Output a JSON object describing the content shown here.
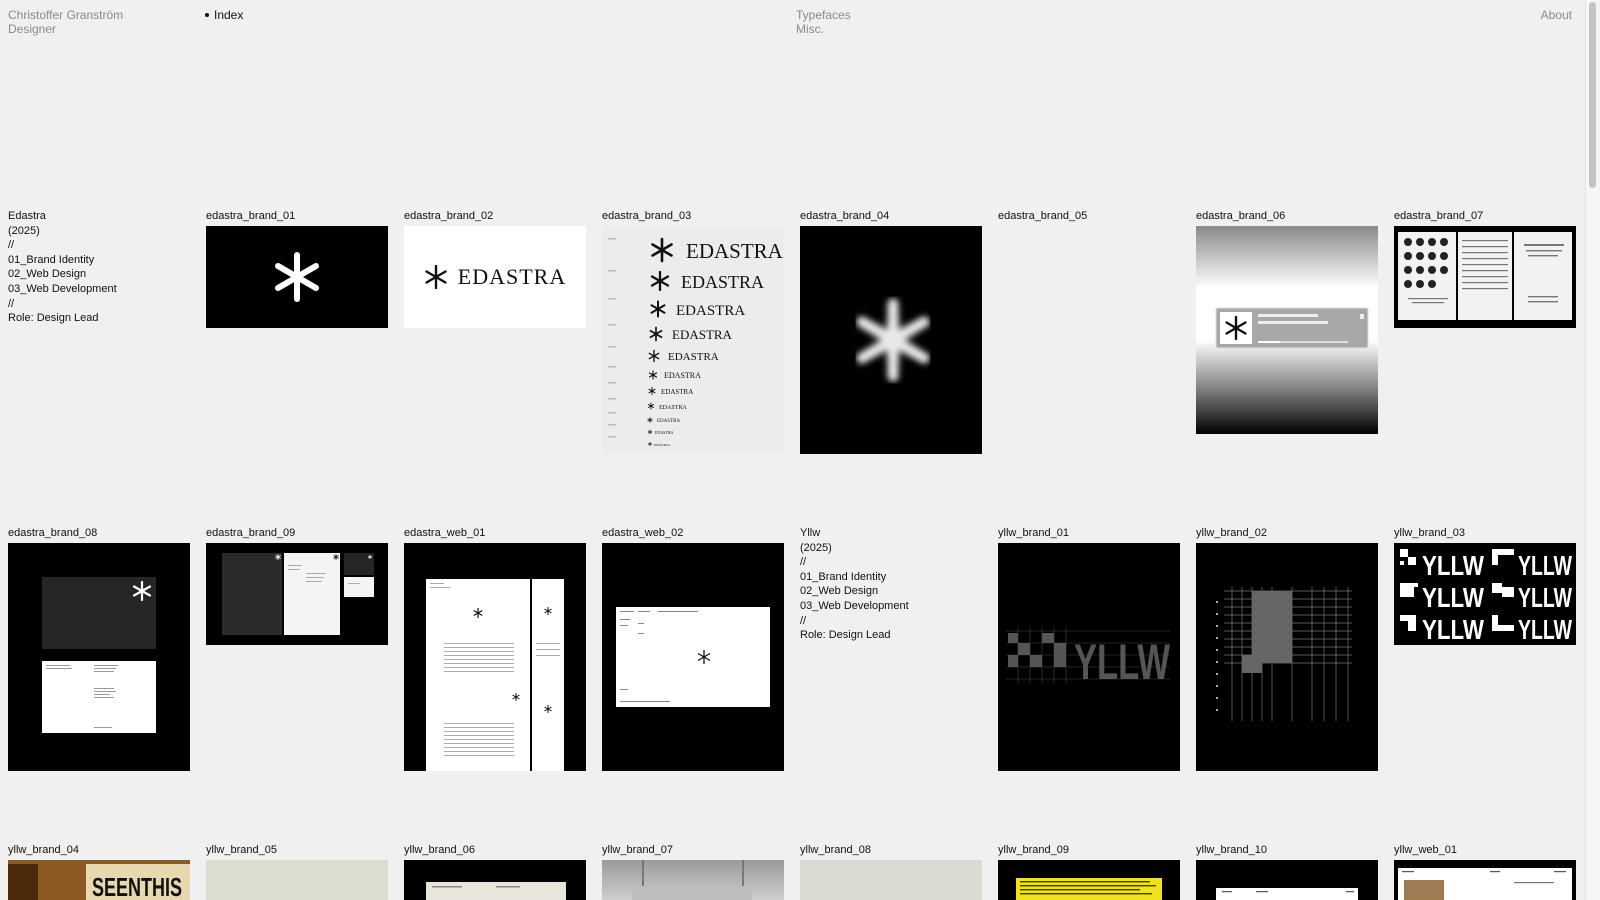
{
  "header": {
    "name": "Christoffer Granström",
    "role": "Designer",
    "index_label": "Index",
    "categories": [
      "Typefaces",
      "Misc."
    ],
    "about": "About"
  },
  "projects": {
    "edastra": {
      "title": "Edastra",
      "year": "(2025)",
      "sep1": "//",
      "services": [
        "01_Brand Identity",
        "02_Web Design",
        "03_Web Development"
      ],
      "sep2": "//",
      "role": "Role: Design Lead"
    },
    "yllw": {
      "title": "Yllw",
      "year": "(2025)",
      "sep1": "//",
      "services": [
        "01_Brand Identity",
        "02_Web Design",
        "03_Web Development"
      ],
      "sep2": "//",
      "role": "Role: Design Lead"
    }
  },
  "row1": [
    "edastra_brand_01",
    "edastra_brand_02",
    "edastra_brand_03",
    "edastra_brand_04",
    "edastra_brand_05",
    "edastra_brand_06",
    "edastra_brand_07"
  ],
  "row2": [
    "edastra_brand_08",
    "edastra_brand_09",
    "edastra_web_01",
    "edastra_web_02",
    "yllw_brand_01",
    "yllw_brand_02",
    "yllw_brand_03"
  ],
  "row3": [
    "yllw_brand_04",
    "yllw_brand_05",
    "yllw_brand_06",
    "yllw_brand_07",
    "yllw_brand_08",
    "yllw_brand_09",
    "yllw_brand_10",
    "yllw_web_01"
  ],
  "thumb_text": {
    "edastra_word": "EDASTRA",
    "yllw_word": "YLLW",
    "seenthis": "SEENTHIS"
  }
}
